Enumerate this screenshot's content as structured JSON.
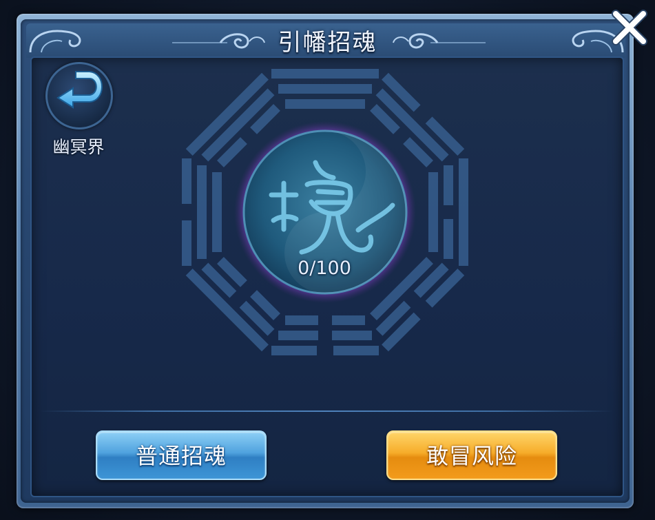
{
  "dialog": {
    "title": "引幡招魂",
    "close_icon": "close-x-icon"
  },
  "back": {
    "icon": "return-arrow-icon",
    "label": "幽冥界"
  },
  "emblem": {
    "icon": "bagua-soul-emblem",
    "glyph": "魂",
    "progress_text": "0/100",
    "progress_fraction": 0
  },
  "actions": {
    "normal_summon_label": "普通招魂",
    "risk_label": "敢冒风险"
  },
  "colors": {
    "panel": "#17294a",
    "frame": "#5d86b3",
    "blue_button": "#3d95d6",
    "orange_button": "#f39b1c"
  }
}
